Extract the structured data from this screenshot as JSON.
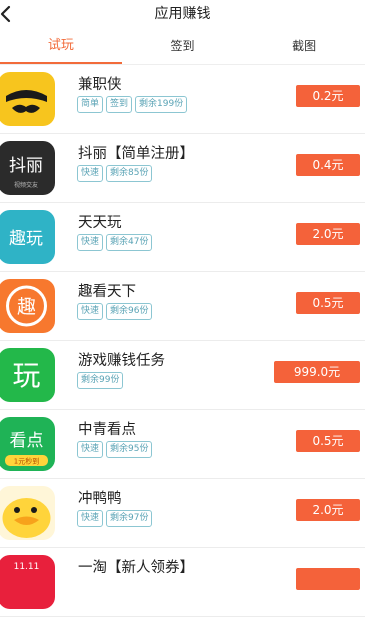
{
  "header": {
    "title": "应用赚钱"
  },
  "tabs": [
    {
      "label": "试玩",
      "active": true
    },
    {
      "label": "签到",
      "active": false
    },
    {
      "label": "截图",
      "active": false
    }
  ],
  "colors": {
    "accent": "#f26b3a",
    "price_bg": "#f4623a",
    "tag": "#5aa3b5"
  },
  "apps": [
    {
      "name": "兼职侠",
      "tags": [
        "简单",
        "签到",
        "剩余199份"
      ],
      "price": "0.2元",
      "icon": "mustache-face-icon"
    },
    {
      "name": "抖丽【简单注册】",
      "tags": [
        "快速",
        "剩余85份"
      ],
      "price": "0.4元",
      "icon": "douli-logo-icon",
      "icon_text": "抖丽",
      "icon_subtext": "视频交友"
    },
    {
      "name": "天天玩",
      "tags": [
        "快速",
        "剩余47份"
      ],
      "price": "2.0元",
      "icon": "qu-wan-logo-icon",
      "icon_text": "趣玩"
    },
    {
      "name": "趣看天下",
      "tags": [
        "快速",
        "剩余96份"
      ],
      "price": "0.5元",
      "icon": "qu-kan-logo-icon",
      "icon_text": "趣"
    },
    {
      "name": "游戏赚钱任务",
      "tags": [
        "剩余99份"
      ],
      "price": "999.0元",
      "icon": "wan-logo-icon",
      "icon_text": "玩"
    },
    {
      "name": "中青看点",
      "tags": [
        "快速",
        "剩余95份"
      ],
      "price": "0.5元",
      "icon": "kandian-logo-icon",
      "icon_text": "看点",
      "icon_subtext": "1元秒到"
    },
    {
      "name": "冲鸭鸭",
      "tags": [
        "快速",
        "剩余97份"
      ],
      "price": "2.0元",
      "icon": "duck-icon"
    },
    {
      "name": "一淘【新人领券】",
      "tags": [],
      "price": "",
      "icon": "yitao-logo-icon",
      "icon_text": "11.11"
    }
  ]
}
